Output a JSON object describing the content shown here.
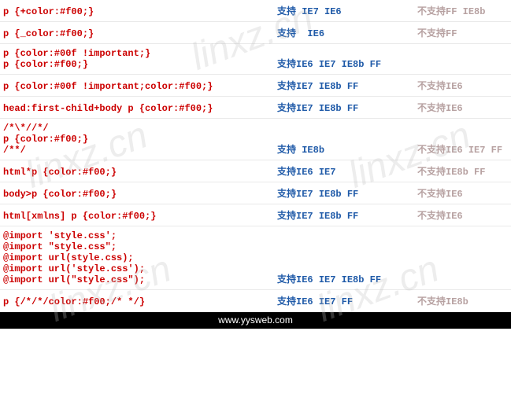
{
  "labels": {
    "support": "支持",
    "nosupport": "不支持"
  },
  "rows": [
    {
      "code": "p {+color:#f00;}",
      "support": " IE7 IE6",
      "nosupport": "FF IE8b"
    },
    {
      "code": "p {_color:#f00;}",
      "support": "  IE6",
      "nosupport": "FF"
    },
    {
      "code": "p {color:#00f !important;}\np {color:#f00;}",
      "support": "IE6 IE7 IE8b FF",
      "nosupport": ""
    },
    {
      "code": "p {color:#00f !important;color:#f00;}",
      "support": "IE7 IE8b FF",
      "nosupport": "IE6"
    },
    {
      "code": "head:first-child+body p {color:#f00;}",
      "support": "IE7 IE8b FF",
      "nosupport": "IE6"
    },
    {
      "code": "/*\\*//*/\np {color:#f00;}\n/**/",
      "support": " IE8b",
      "nosupport": "IE6 IE7 FF"
    },
    {
      "code": "html*p {color:#f00;}",
      "support": "IE6 IE7",
      "nosupport": "IE8b FF"
    },
    {
      "code": "body>p {color:#f00;}",
      "support": "IE7 IE8b FF",
      "nosupport": "IE6"
    },
    {
      "code": "html[xmlns] p {color:#f00;}",
      "support": "IE7 IE8b FF",
      "nosupport": "IE6"
    },
    {
      "code": "@import 'style.css';\n@import \"style.css\";\n@import url(style.css);\n@import url('style.css');\n@import url(\"style.css\");",
      "support": "IE6 IE7 IE8b FF",
      "nosupport": ""
    },
    {
      "code": "p {/*/*/color:#f00;/* */}",
      "support": "IE6 IE7 FF",
      "nosupport": "IE8b"
    }
  ],
  "footer": "www.yysweb.com",
  "watermark_text": "linxz.cn"
}
